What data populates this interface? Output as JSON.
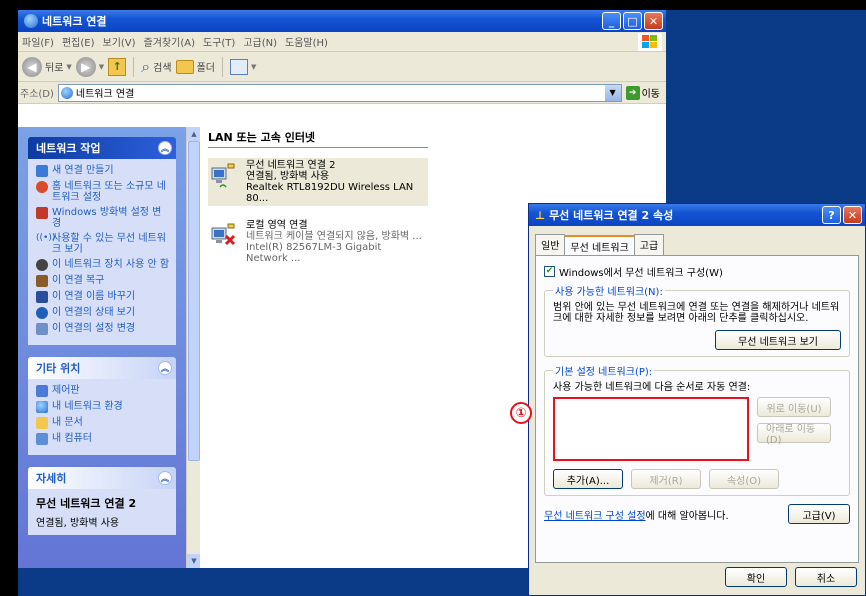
{
  "explorer": {
    "title": "네트워크 연결",
    "menu": [
      "파일(F)",
      "편집(E)",
      "보기(V)",
      "즐겨찾기(A)",
      "도구(T)",
      "고급(N)",
      "도움말(H)"
    ],
    "toolbar": {
      "back": "뒤로",
      "search": "검색",
      "folders": "폴더"
    },
    "address": {
      "label": "주소(D)",
      "value": "네트워크 연결",
      "go": "이동"
    }
  },
  "sidebar": {
    "network_tasks": {
      "title": "네트워크 작업",
      "items": [
        "새 연결 만들기",
        "홈 네트워크 또는 소규모 네트워크 설정",
        "Windows 방화벽 설정 변경",
        "사용할 수 있는 무선 네트워크 보기",
        "이 네트워크 장치 사용 안 함",
        "이 연결 복구",
        "이 연결 이름 바꾸기",
        "이 연결의 상태 보기",
        "이 연결의 설정 변경"
      ]
    },
    "other_places": {
      "title": "기타 위치",
      "items": [
        "제어판",
        "내 네트워크 환경",
        "내 문서",
        "내 컴퓨터"
      ]
    },
    "details": {
      "title": "자세히",
      "name": "무선 네트워크 연결 2",
      "status": "연결됨, 방화벽 사용"
    }
  },
  "main": {
    "group_header": "LAN 또는 고속 인터넷",
    "connections": [
      {
        "name": "무선 네트워크 연결 2",
        "status": "연결됨, 방화벽 사용",
        "device": "Realtek RTL8192DU Wireless LAN 80..."
      },
      {
        "name": "로컬 영역 연결",
        "status": "네트워크 케이블 연결되지 않음, 방화벽 ...",
        "device": "Intel(R) 82567LM-3 Gigabit Network ..."
      }
    ]
  },
  "dialog": {
    "title": "무선 네트워크 연결 2 속성",
    "tabs": [
      "일반",
      "무선 네트워크",
      "고급"
    ],
    "use_windows_config": "Windows에서 무선 네트워크 구성(W)",
    "available": {
      "legend": "사용 가능한 네트워크(N):",
      "text": "범위 안에 있는 무선 네트워크에 연결 또는 연결을 해제하거나 네트워크에 대한 자세한 정보를 보려면 아래의 단추를 클릭하십시오.",
      "view_button": "무선 네트워크 보기"
    },
    "preferred": {
      "legend": "기본 설정 네트워크(P):",
      "text": "사용 가능한 네트워크에 다음 순서로 자동 연결:",
      "up_button": "위로 이동(U)",
      "down_button": "아래로 이동(D)",
      "add_button": "추가(A)...",
      "remove_button": "제거(R)",
      "properties_button": "속성(O)"
    },
    "learn_link": "무선 네트워크 구성 설정",
    "learn_suffix": "에 대해 알아봅니다.",
    "advanced_button": "고급(V)",
    "ok_button": "확인",
    "cancel_button": "취소"
  },
  "annotation": {
    "marker": "①"
  }
}
